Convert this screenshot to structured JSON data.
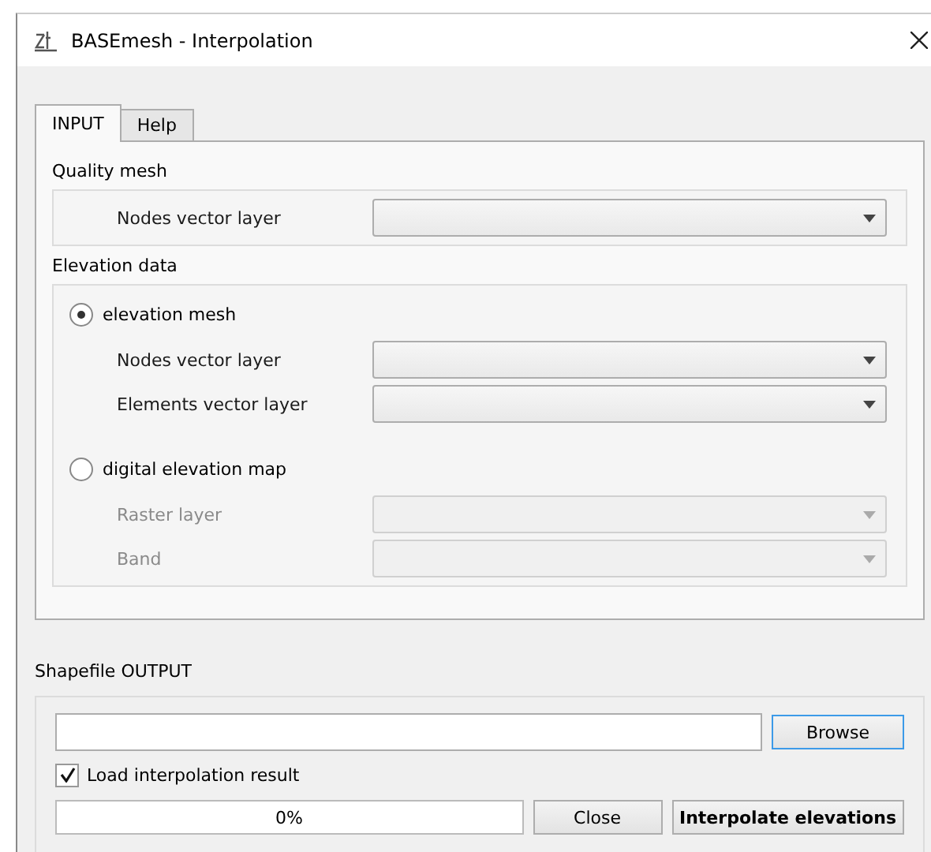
{
  "window": {
    "title": "BASEmesh - Interpolation"
  },
  "tabs": [
    {
      "label": "INPUT",
      "selected": true
    },
    {
      "label": "Help",
      "selected": false
    }
  ],
  "quality_mesh": {
    "title": "Quality mesh",
    "fields": [
      {
        "label": "Nodes vector layer",
        "disabled": false
      }
    ]
  },
  "elevation_data": {
    "title": "Elevation data",
    "options": [
      {
        "label": "elevation mesh",
        "selected": true,
        "fields": [
          {
            "label": "Nodes vector layer",
            "disabled": false
          },
          {
            "label": "Elements vector layer",
            "disabled": false
          }
        ]
      },
      {
        "label": "digital elevation map",
        "selected": false,
        "fields": [
          {
            "label": "Raster layer",
            "disabled": true
          },
          {
            "label": "Band",
            "disabled": true
          }
        ]
      }
    ]
  },
  "output": {
    "title": "Shapefile OUTPUT",
    "browse_button": "Browse",
    "load_result": {
      "label": "Load interpolation result",
      "checked": true
    },
    "progress": {
      "level": 0,
      "text": "0%"
    },
    "buttons": [
      {
        "label": "Close",
        "kind": "normal"
      },
      {
        "label": "Interpolate elevations",
        "kind": "bold"
      }
    ]
  }
}
